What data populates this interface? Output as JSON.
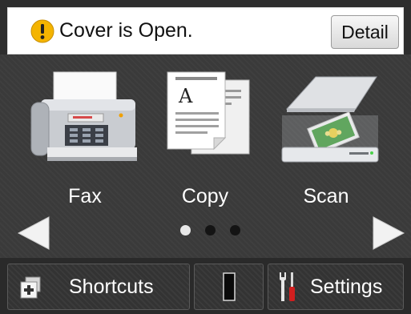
{
  "status": {
    "message": "Cover is Open.",
    "detail_label": "Detail",
    "icon": "warning-icon",
    "icon_color": "#f4b400"
  },
  "apps": [
    {
      "label": "Fax",
      "icon": "fax-icon"
    },
    {
      "label": "Copy",
      "icon": "copy-icon"
    },
    {
      "label": "Scan",
      "icon": "scan-icon"
    }
  ],
  "pagination": {
    "current_page": 1,
    "total_pages": 3
  },
  "bottom_bar": {
    "shortcuts_label": "Shortcuts",
    "shortcuts_icon": "shortcuts-icon",
    "toner_icon": "toner-icon",
    "settings_label": "Settings",
    "settings_icon": "tools-icon"
  }
}
